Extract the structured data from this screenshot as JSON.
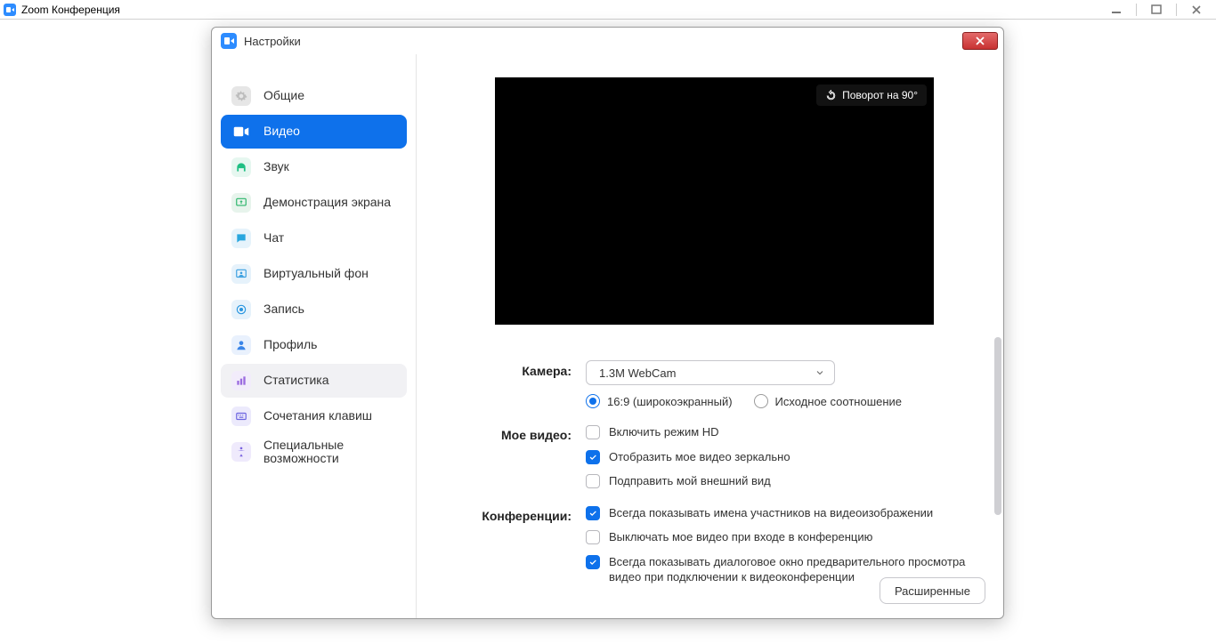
{
  "app": {
    "title": "Zoom Конференция"
  },
  "dialog": {
    "title": "Настройки"
  },
  "nav": {
    "general": "Общие",
    "video": "Видео",
    "audio": "Звук",
    "share": "Демонстрация экрана",
    "chat": "Чат",
    "vb": "Виртуальный фон",
    "record": "Запись",
    "profile": "Профиль",
    "stats": "Статистика",
    "keys": "Сочетания клавиш",
    "access": "Специальные возможности"
  },
  "video": {
    "rotate_label": "Поворот на 90°",
    "camera_label": "Камера:",
    "camera_value": "1.3M WebCam",
    "ratio_wide": "16:9 (широкоэкранный)",
    "ratio_orig": "Исходное соотношение",
    "myvideo_label": "Мое видео:",
    "hd": "Включить режим HD",
    "mirror": "Отобразить мое видео зеркально",
    "touchup": "Подправить мой внешний вид",
    "meetings_label": "Конференции:",
    "show_names": "Всегда показывать имена участников на видеоизображении",
    "mute_on_join": "Выключать мое видео при входе в конференцию",
    "preview_dialog": "Всегда показывать диалоговое окно предварительного просмотра видео при подключении к видеоконференции",
    "advanced": "Расширенные",
    "ratio_selected": "wide",
    "checks": {
      "hd": false,
      "mirror": true,
      "touchup": false,
      "show_names": true,
      "mute_on_join": false,
      "preview_dialog": true
    }
  }
}
